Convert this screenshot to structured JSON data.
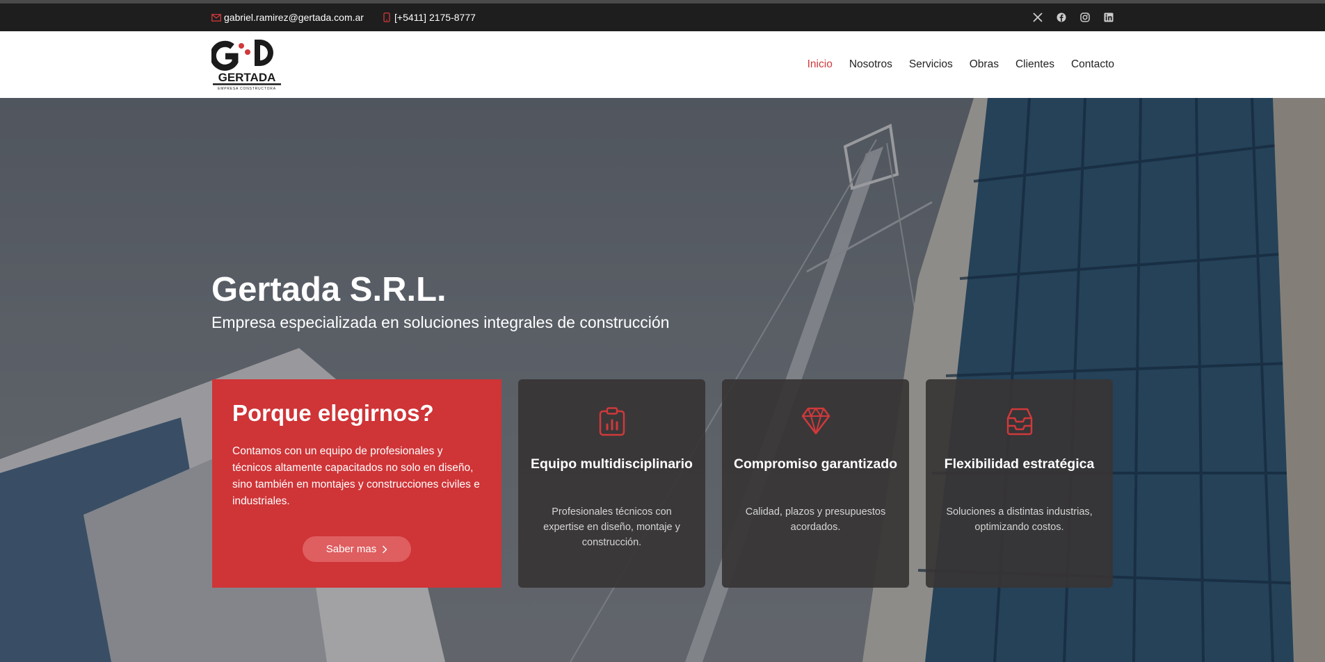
{
  "topbar": {
    "email": "gabriel.ramirez@gertada.com.ar",
    "phone": "[+5411] 2175-8777",
    "socials": [
      "x-icon",
      "facebook-icon",
      "instagram-icon",
      "linkedin-icon"
    ]
  },
  "logo": {
    "mark": "G·D",
    "name": "GERTADA",
    "tagline": "EMPRESA CONSTRUCTORA"
  },
  "nav": [
    "Inicio",
    "Nosotros",
    "Servicios",
    "Obras",
    "Clientes",
    "Contacto"
  ],
  "nav_active": "Inicio",
  "hero": {
    "title": "Gertada S.R.L.",
    "subtitle": "Empresa especializada en soluciones integrales de construcción"
  },
  "why": {
    "title": "Porque elegirnos?",
    "text": "Contamos con un equipo de profesionales y técnicos altamente capacitados no solo en diseño, sino también en montajes y construcciones civiles e industriales.",
    "button": "Saber mas"
  },
  "cards": [
    {
      "icon": "clipboard-chart-icon",
      "title": "Equipo multidisciplinario",
      "text": "Profesionales técnicos con expertise en diseño, montaje y construcción."
    },
    {
      "icon": "diamond-icon",
      "title": "Compromiso garantizado",
      "text": "Calidad, plazos y presupuestos acordados."
    },
    {
      "icon": "inbox-stack-icon",
      "title": "Flexibilidad estratégica",
      "text": "Soluciones a distintas industrias, optimizando costos."
    }
  ],
  "colors": {
    "accent": "#cf3437",
    "topbar": "#1f1e1e",
    "card": "#373434"
  }
}
